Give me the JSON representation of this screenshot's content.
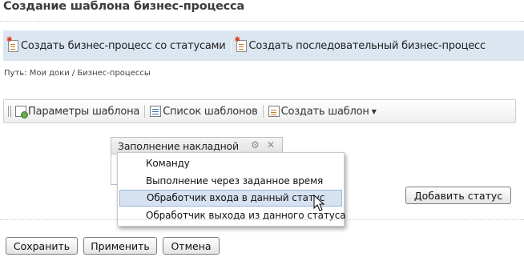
{
  "page": {
    "title": "Создание шаблона бизнес-процесса"
  },
  "actions": {
    "create_status_bp": "Создать бизнес-процесс со статусами",
    "create_sequential_bp": "Создать последовательный бизнес-процесс"
  },
  "breadcrumb": "Путь: Мои доки / Бизнес-процессы",
  "toolbar": {
    "template_params": "Параметры шаблона",
    "template_list": "Список шаблонов",
    "create_template": "Создать шаблон"
  },
  "status_card": {
    "title": "Заполнение накладной",
    "gear_glyph": "⚙",
    "close_glyph": "✕"
  },
  "context_menu": {
    "items": [
      {
        "label": "Команду"
      },
      {
        "label": "Выполнение через заданное время"
      },
      {
        "label": "Обработчик входа в данный статус",
        "active": true
      },
      {
        "label": "Обработчик выхода из данного статуса"
      }
    ]
  },
  "buttons": {
    "add_status": "Добавить статус",
    "save": "Сохранить",
    "apply": "Применить",
    "cancel": "Отмена"
  },
  "colors": {
    "action_bar_bg": "#dbe6f0",
    "menu_highlight": "#d6e2f2"
  },
  "icons": [
    "doc-new-icon",
    "gear-icon",
    "list-icon",
    "close-icon",
    "chevron-down-icon",
    "mouse-cursor-icon"
  ]
}
